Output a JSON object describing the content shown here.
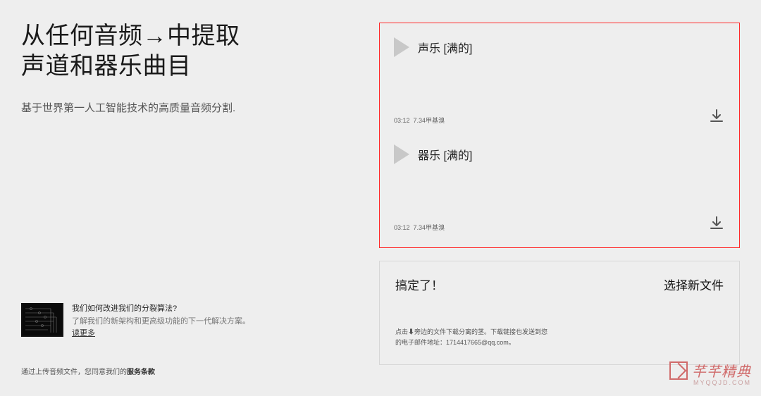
{
  "headline": {
    "line1": "从任何音频→中提取",
    "line2": "声道和器乐曲目"
  },
  "subhead": "基于世界第一人工智能技术的高质量音频分割.",
  "promo": {
    "title": "我们如何改进我们的分裂算法?",
    "desc": "了解我们的新架构和更高级功能的下一代解决方案。",
    "more": "读更多"
  },
  "tos": {
    "prefix": "通过上传音频文件，您同意我们的",
    "terms": "服务条款"
  },
  "tracks": [
    {
      "title": "声乐 [满的]",
      "duration": "03:12",
      "size": "7.34甲基溴"
    },
    {
      "title": "器乐 [满的]",
      "duration": "03:12",
      "size": "7.34甲基溴"
    }
  ],
  "done": {
    "label": "搞定了！",
    "newfile": "选择新文件",
    "hint_line1": "点击⬇旁边的文件下载分离的茎。下载链接也发送到您",
    "hint_line2": "的电子邮件地址：1714417665@qq.com。"
  },
  "watermark": {
    "text": "芊芊精典",
    "small": "MYQQJD.COM"
  }
}
